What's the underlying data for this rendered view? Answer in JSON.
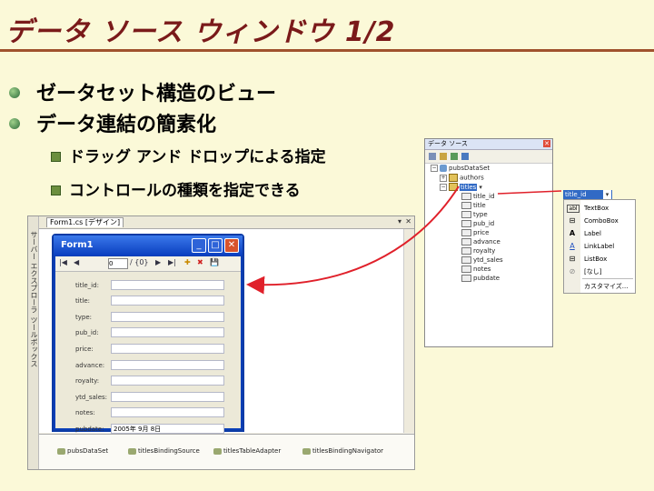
{
  "slide": {
    "title": "データ ソース ウィンドウ 1/2",
    "bullets": [
      {
        "text": "ゼータセット構造のビュー"
      },
      {
        "text": "データ連結の簡素化"
      }
    ],
    "subbullets": [
      {
        "text": "ドラッグ アンド ドロップによる指定"
      },
      {
        "text": "コントロールの種類を指定できる"
      }
    ]
  },
  "designer": {
    "tab_label": "Form1.cs [デザイン]",
    "side_tabs": [
      "サーバー エクスプローラ",
      "ツールボックス"
    ],
    "tab_close": "✕",
    "tab_down": "▾",
    "tray_items": [
      "pubsDataSet",
      "titlesBindingSource",
      "titlesTableAdapter",
      "titlesBindingNavigator"
    ]
  },
  "form1": {
    "title": "Form1",
    "min": "_",
    "max": "□",
    "close": "✕",
    "navigator": {
      "first": "|◀",
      "prev": "◀",
      "position": "0",
      "count": "/ {0}",
      "next": "▶",
      "last": "▶|",
      "add": "✚",
      "delete": "✖",
      "save": "💾"
    },
    "fields": [
      {
        "label": "title_id:",
        "value": ""
      },
      {
        "label": "title:",
        "value": ""
      },
      {
        "label": "type:",
        "value": ""
      },
      {
        "label": "pub_id:",
        "value": ""
      },
      {
        "label": "price:",
        "value": ""
      },
      {
        "label": "advance:",
        "value": ""
      },
      {
        "label": "royalty:",
        "value": ""
      },
      {
        "label": "ytd_sales:",
        "value": ""
      },
      {
        "label": "notes:",
        "value": ""
      },
      {
        "label": "pubdate:",
        "value": "2005年 9月 8日"
      }
    ]
  },
  "data_source_panel": {
    "title": "データ ソース",
    "close": "✕",
    "tree": {
      "dataset": "pubsDataSet",
      "authors": "authors",
      "titles": "titles",
      "columns": [
        "title_id",
        "title",
        "type",
        "pub_id",
        "price",
        "advance",
        "royalty",
        "ytd_sales",
        "notes",
        "pubdate"
      ]
    }
  },
  "control_dropdown": {
    "selected": "title_id",
    "items": [
      {
        "glyph": "abl",
        "label": "TextBox"
      },
      {
        "glyph": "⊟",
        "label": "ComboBox"
      },
      {
        "glyph": "A",
        "label": "Label"
      },
      {
        "glyph": "A",
        "label": "LinkLabel"
      },
      {
        "glyph": "⊟",
        "label": "ListBox"
      },
      {
        "glyph": "⊘",
        "label": "[なし]"
      },
      {
        "glyph": "",
        "label": "カスタマイズ..."
      }
    ]
  },
  "colors": {
    "title": "#7a1a1a",
    "background": "#fbf9d8",
    "arrow": "#e0202a",
    "xp_blue": "#0a3fb8"
  }
}
